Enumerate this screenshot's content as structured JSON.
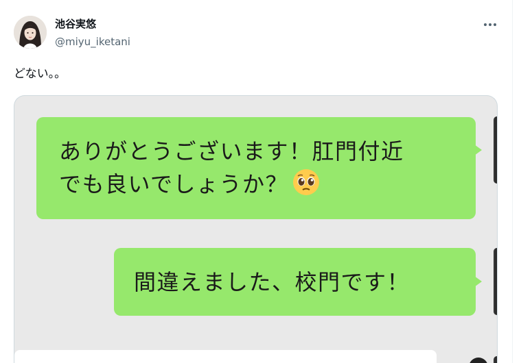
{
  "author": {
    "display_name": "池谷実悠",
    "handle": "@miyu_iketani"
  },
  "tweet": {
    "text": "どない。。"
  },
  "media": {
    "bubbles": [
      {
        "line1": "ありがとうございます！肛門付近",
        "line2": "でも良いでしょうか？",
        "emoji": "pleading-face"
      },
      {
        "line1": "間違えました、校門です！"
      }
    ],
    "colors": {
      "bubble": "#96e86c",
      "chat_background": "#e9e9e9"
    }
  },
  "icons": {
    "more": "more-horizontal-icon",
    "emoji": "pleading-face-emoji"
  }
}
